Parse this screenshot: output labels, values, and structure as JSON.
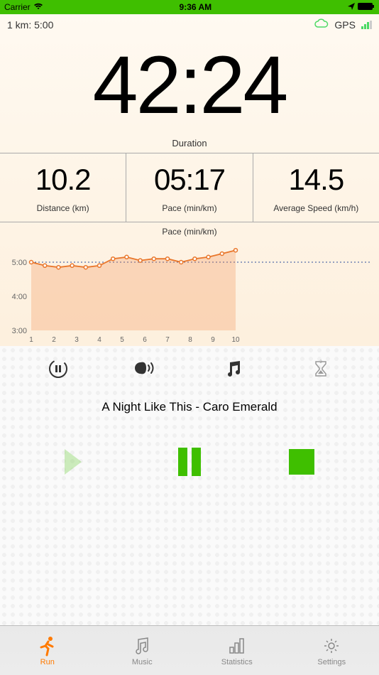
{
  "status_bar": {
    "carrier": "Carrier",
    "time": "9:36 AM"
  },
  "info_bar": {
    "left": "1 km: 5:00",
    "gps_label": "GPS"
  },
  "duration": {
    "value": "42:24",
    "label": "Duration"
  },
  "stats": [
    {
      "value": "10.2",
      "label": "Distance (km)"
    },
    {
      "value": "05:17",
      "label": "Pace (min/km)"
    },
    {
      "value": "14.5",
      "label": "Average Speed (km/h)"
    }
  ],
  "chart_data": {
    "type": "line",
    "title": "Pace (min/km)",
    "xlabel": "",
    "ylabel": "",
    "x": [
      1,
      2,
      3,
      4,
      5,
      6,
      7,
      8,
      9,
      10
    ],
    "values": [
      5.0,
      4.9,
      4.85,
      4.9,
      4.85,
      4.9,
      5.1,
      5.15,
      5.05,
      5.1,
      5.1,
      5.0,
      5.1,
      5.15,
      5.25,
      5.35
    ],
    "ylim": [
      3.0,
      5.5
    ],
    "y_ticks": [
      "3:00",
      "4:00",
      "5:00"
    ],
    "target_line": 5.0
  },
  "now_playing": "A Night Like This - Caro Emerald",
  "tabs": [
    {
      "label": "Run"
    },
    {
      "label": "Music"
    },
    {
      "label": "Statistics"
    },
    {
      "label": "Settings"
    }
  ]
}
